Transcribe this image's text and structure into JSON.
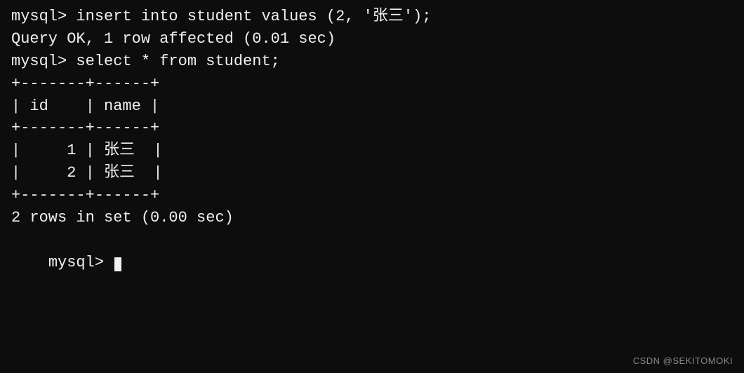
{
  "terminal": {
    "lines": [
      "mysql> insert into student values (2, '张三');",
      "Query OK, 1 row affected (0.01 sec)",
      "",
      "mysql> select * from student;",
      "+-------+------+",
      "| id    | name |",
      "+-------+------+",
      "|     1 | 张三  |",
      "|     2 | 张三  |",
      "+-------+------+",
      "2 rows in set (0.00 sec)",
      "",
      "mysql> "
    ],
    "watermark": "CSDN @SEKITOMOKI"
  }
}
